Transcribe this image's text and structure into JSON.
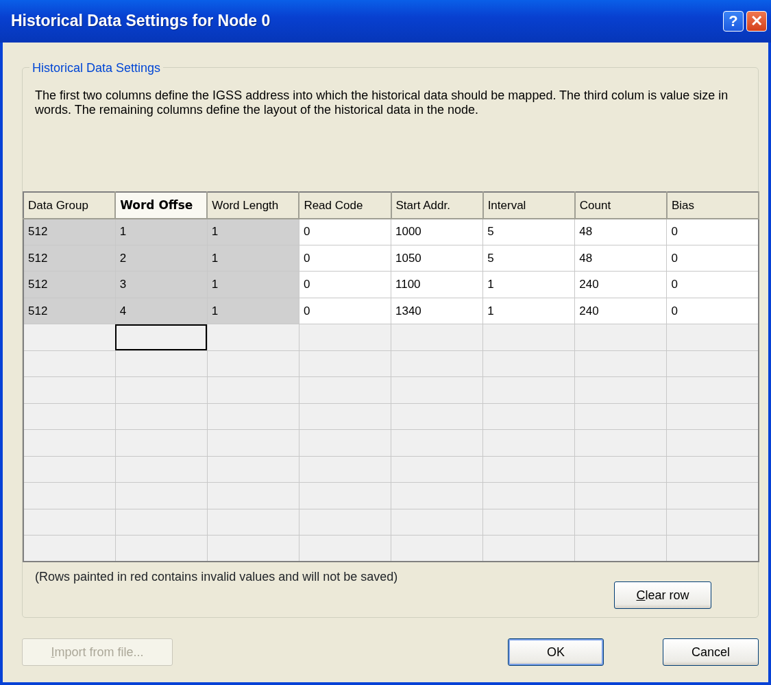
{
  "window": {
    "title": "Historical Data Settings for Node 0",
    "buttons": [
      {
        "kind": "help",
        "label": "?"
      },
      {
        "kind": "close",
        "label": "✕"
      }
    ]
  },
  "group": {
    "title": "Historical Data Settings",
    "description": "The first two columns define the IGSS address into which the historical data should be mapped. The third colum is value size in words. The remaining columns define the layout of the historical data in the node."
  },
  "table": {
    "columns": [
      {
        "label": "Data Group",
        "selected": false,
        "kind": "key",
        "current": false
      },
      {
        "label": "Word Offse",
        "selected": true,
        "kind": "key",
        "current": true
      },
      {
        "label": "Word Length",
        "selected": false,
        "kind": "key",
        "current": false
      },
      {
        "label": "Read Code",
        "selected": false,
        "kind": "value",
        "current": false
      },
      {
        "label": "Start Addr.",
        "selected": false,
        "kind": "value",
        "current": false
      },
      {
        "label": "Interval",
        "selected": false,
        "kind": "value",
        "current": false
      },
      {
        "label": "Count",
        "selected": false,
        "kind": "value",
        "current": false
      },
      {
        "label": "Bias",
        "selected": false,
        "kind": "value",
        "current": false
      }
    ],
    "rows": [
      [
        "512",
        "1",
        "1",
        "0",
        "1000",
        "5",
        "48",
        "0"
      ],
      [
        "512",
        "2",
        "1",
        "0",
        "1050",
        "5",
        "48",
        "0"
      ],
      [
        "512",
        "3",
        "1",
        "0",
        "1100",
        "1",
        "240",
        "0"
      ],
      [
        "512",
        "4",
        "1",
        "0",
        "1340",
        "1",
        "240",
        "0"
      ]
    ]
  },
  "note": "(Rows painted in red contains invalid values and will not be saved)",
  "buttons": [
    {
      "label": "Clear row",
      "kind": "clear",
      "disabled": false,
      "underline_first": true
    },
    {
      "label": "Import from file...",
      "kind": "import",
      "disabled": true,
      "underline_first": true
    },
    {
      "label": "OK",
      "kind": "ok",
      "disabled": false,
      "underline_first": false
    },
    {
      "label": "Cancel",
      "kind": "cancel",
      "disabled": false,
      "underline_first": false
    }
  ]
}
